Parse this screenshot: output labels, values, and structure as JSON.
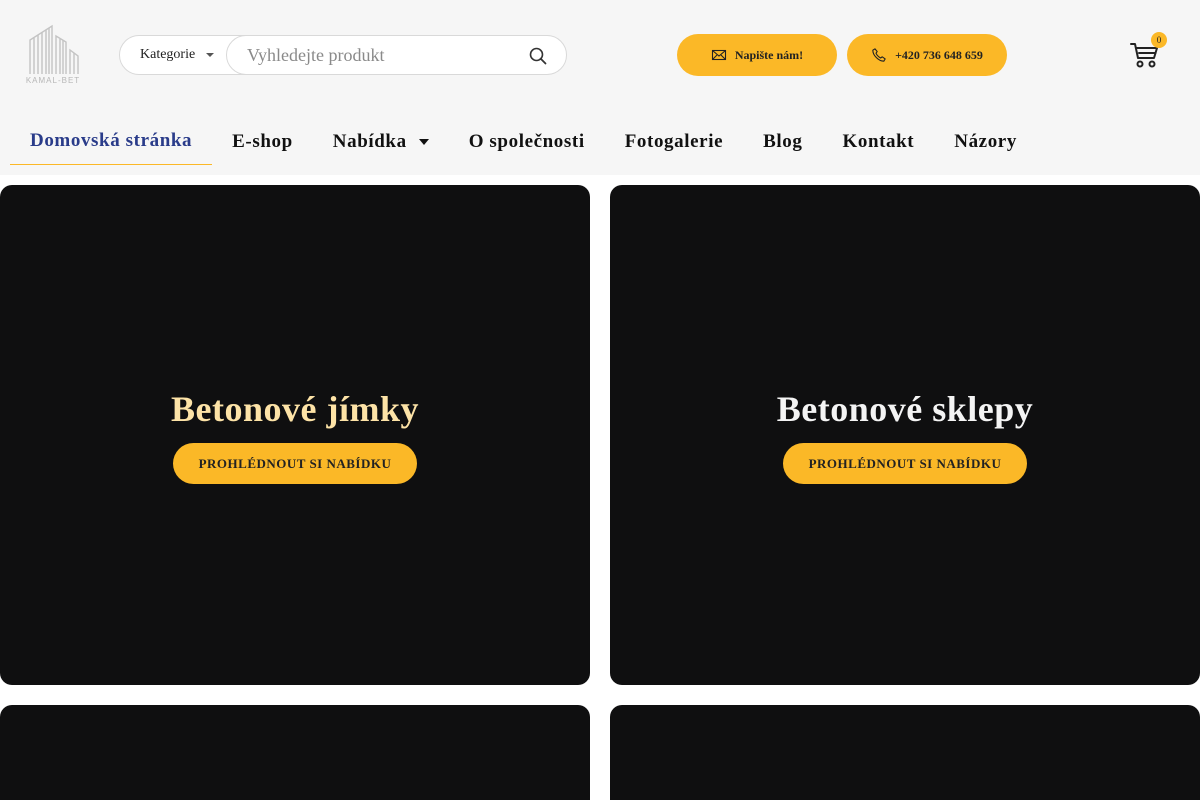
{
  "logo": {
    "text": "KAMAL-BET",
    "icon": "building-logo"
  },
  "search": {
    "category_label": "Kategorie",
    "placeholder": "Vyhledejte produkt",
    "search_icon": "search-icon"
  },
  "header_buttons": {
    "mail_label": "Napište nám!",
    "mail_icon": "mail-icon",
    "phone_label": "+420 736 648 659",
    "phone_icon": "phone-icon"
  },
  "cart": {
    "count": "0",
    "icon": "cart-icon"
  },
  "nav": {
    "items": [
      {
        "label": "Domovská stránka",
        "active": true
      },
      {
        "label": "E-shop"
      },
      {
        "label": "Nabídka",
        "has_dropdown": true
      },
      {
        "label": "O společnosti"
      },
      {
        "label": "Fotogalerie"
      },
      {
        "label": "Blog"
      },
      {
        "label": "Kontakt"
      },
      {
        "label": "Názory"
      }
    ]
  },
  "cards": [
    {
      "title": "Betonové jímky",
      "button": "PROHLÉDNOUT SI NABÍDKU"
    },
    {
      "title": "Betonové sklepy",
      "button": "PROHLÉDNOUT SI NABÍDKU"
    }
  ],
  "colors": {
    "accent": "#fbb827",
    "nav_active": "#2a3c8a",
    "card_bg": "#0f0f10",
    "header_bg": "#f6f6f6",
    "card_title_highlight": "#fde3a7"
  }
}
